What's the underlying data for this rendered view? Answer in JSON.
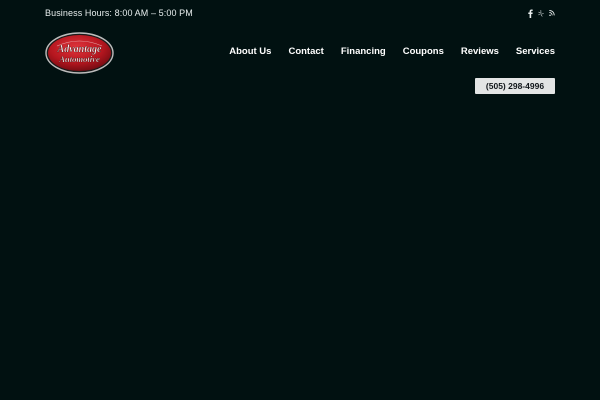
{
  "topbar": {
    "hours": "Business Hours: 8:00 AM – 5:00 PM",
    "social": [
      {
        "icon": "facebook-icon"
      },
      {
        "icon": "yelp-icon"
      },
      {
        "icon": "rss-icon"
      }
    ]
  },
  "logo": {
    "line1": "Advantage",
    "line2": "Automotive"
  },
  "nav": {
    "items": [
      {
        "label": "About Us"
      },
      {
        "label": "Contact"
      },
      {
        "label": "Financing"
      },
      {
        "label": "Coupons"
      },
      {
        "label": "Reviews"
      },
      {
        "label": "Services"
      }
    ]
  },
  "phone": {
    "label": "(505) 298-4996"
  },
  "colors": {
    "background": "#011111",
    "logo_red": "#c8202a",
    "button_bg": "#e3e5e5"
  }
}
